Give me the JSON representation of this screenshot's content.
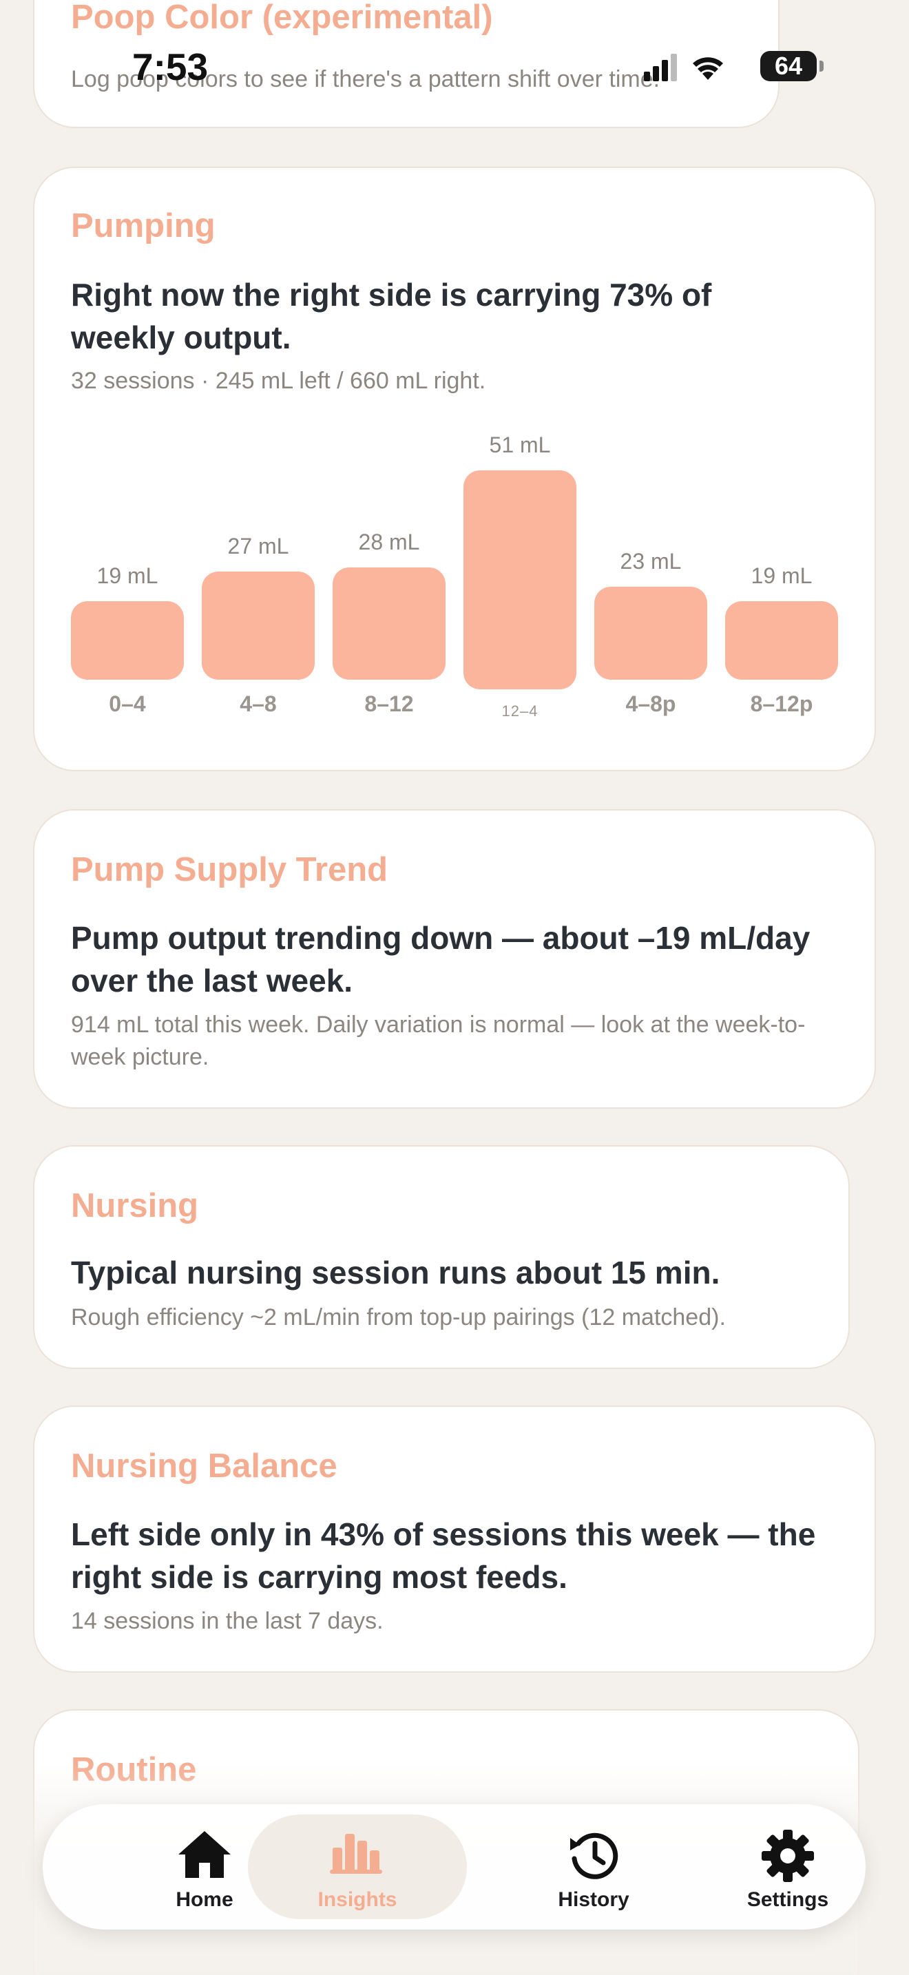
{
  "status_bar": {
    "time": "7:53",
    "battery": "64"
  },
  "cards": {
    "poop": {
      "title": "Poop Color (experimental)",
      "sub": "Log poop colors to see if there's a pattern shift over time."
    },
    "pumping": {
      "title": "Pumping",
      "headline": "Right now the right side is carrying 73% of weekly output.",
      "sub": "32 sessions · 245 mL left / 660 mL right."
    },
    "supply": {
      "title": "Pump Supply Trend",
      "headline": "Pump output trending down — about –19 mL/day over the last week.",
      "sub": "914 mL total this week. Daily variation is normal — look at the week-to-week picture."
    },
    "nursing": {
      "title": "Nursing",
      "headline": "Typical nursing session runs about 15 min.",
      "sub": "Rough efficiency ~2 mL/min from top-up pairings (12 matched)."
    },
    "balance": {
      "title": "Nursing Balance",
      "headline": "Left side only in 43% of sessions this week — the right side is carrying most feeds.",
      "sub": "14 sessions in the last 7 days."
    },
    "routine": {
      "title": "Routine"
    }
  },
  "chart_data": {
    "type": "bar",
    "categories": [
      "0–4",
      "4–8",
      "8–12",
      "12–4",
      "4–8p",
      "8–12p"
    ],
    "values": [
      19,
      27,
      28,
      51,
      23,
      19
    ],
    "value_labels": [
      "19 mL",
      "27 mL",
      "28 mL",
      "51 mL",
      "23 mL",
      "19 mL"
    ],
    "bar_color": "#fbb59d",
    "highlighted_index": 3
  },
  "tabbar": {
    "tabs": [
      {
        "label": "Home",
        "icon": "home-icon"
      },
      {
        "label": "Insights",
        "icon": "bar-chart-icon",
        "active": true
      },
      {
        "label": "History",
        "icon": "history-icon"
      },
      {
        "label": "Settings",
        "icon": "gear-icon"
      }
    ]
  },
  "colors": {
    "accent": "#f5ad92",
    "background": "#f4f0eb",
    "bar": "#fbb59d"
  }
}
